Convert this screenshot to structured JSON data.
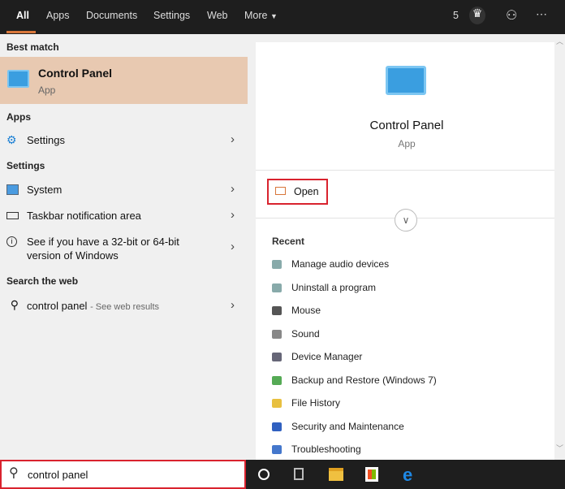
{
  "tabs": [
    {
      "label": "All"
    },
    {
      "label": "Apps"
    },
    {
      "label": "Documents"
    },
    {
      "label": "Settings"
    },
    {
      "label": "Web"
    },
    {
      "label": "More"
    }
  ],
  "top_right": {
    "count": "5"
  },
  "left": {
    "best_match_header": "Best match",
    "best": {
      "title": "Control Panel",
      "sub": "App"
    },
    "apps_header": "Apps",
    "apps": [
      {
        "label": "Settings"
      }
    ],
    "settings_header": "Settings",
    "settings": [
      {
        "label": "System"
      },
      {
        "label": "Taskbar notification area"
      },
      {
        "label": "See if you have a 32-bit or 64-bit",
        "label2": "version of Windows"
      }
    ],
    "web_header": "Search the web",
    "web": {
      "query": "control panel",
      "suffix": "- See web results"
    }
  },
  "right": {
    "title": "Control Panel",
    "sub": "App",
    "open": "Open",
    "recent_header": "Recent",
    "recent": [
      "Manage audio devices",
      "Uninstall a program",
      "Mouse",
      "Sound",
      "Device Manager",
      "Backup and Restore (Windows 7)",
      "File History",
      "Security and Maintenance",
      "Troubleshooting"
    ]
  },
  "search": {
    "value": "control panel"
  },
  "colors": {
    "accent": "#d8763a",
    "highlight": "#e8c9b1",
    "red_box": "#d9232e"
  }
}
